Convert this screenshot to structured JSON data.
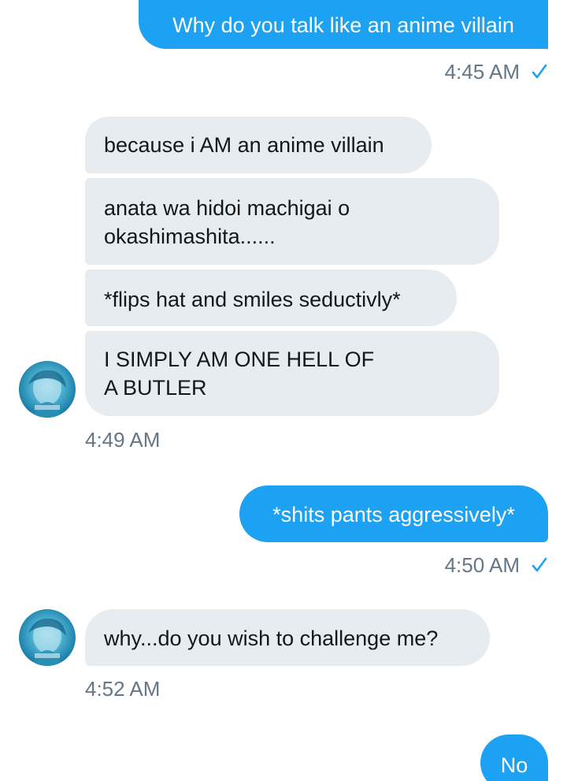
{
  "conversation": {
    "m1": {
      "text": "Why do you talk like an anime villain",
      "time": "4:45 AM"
    },
    "group1": {
      "messages": [
        {
          "lines": [
            "because i AM an anime villain"
          ]
        },
        {
          "lines": [
            "anata wa hidoi machigai o",
            "okashimashita......"
          ]
        },
        {
          "lines": [
            "*flips hat and smiles seductivly*"
          ]
        },
        {
          "lines": [
            "I SIMPLY AM ONE HELL OF",
            "A BUTLER"
          ]
        }
      ],
      "time": "4:49 AM"
    },
    "m2": {
      "text": "*shits pants aggressively*",
      "time": "4:50 AM"
    },
    "m3": {
      "text": "why...do you wish to challenge me?",
      "time": "4:52 AM"
    },
    "m4": {
      "text": "No"
    }
  },
  "colors": {
    "sent_bubble": "#1da1f2",
    "received_bubble": "#e6ecf0",
    "timestamp": "#657786",
    "check": "#1da1f2"
  },
  "icons": {
    "read_receipt": "check-icon",
    "avatar": "avatar"
  }
}
